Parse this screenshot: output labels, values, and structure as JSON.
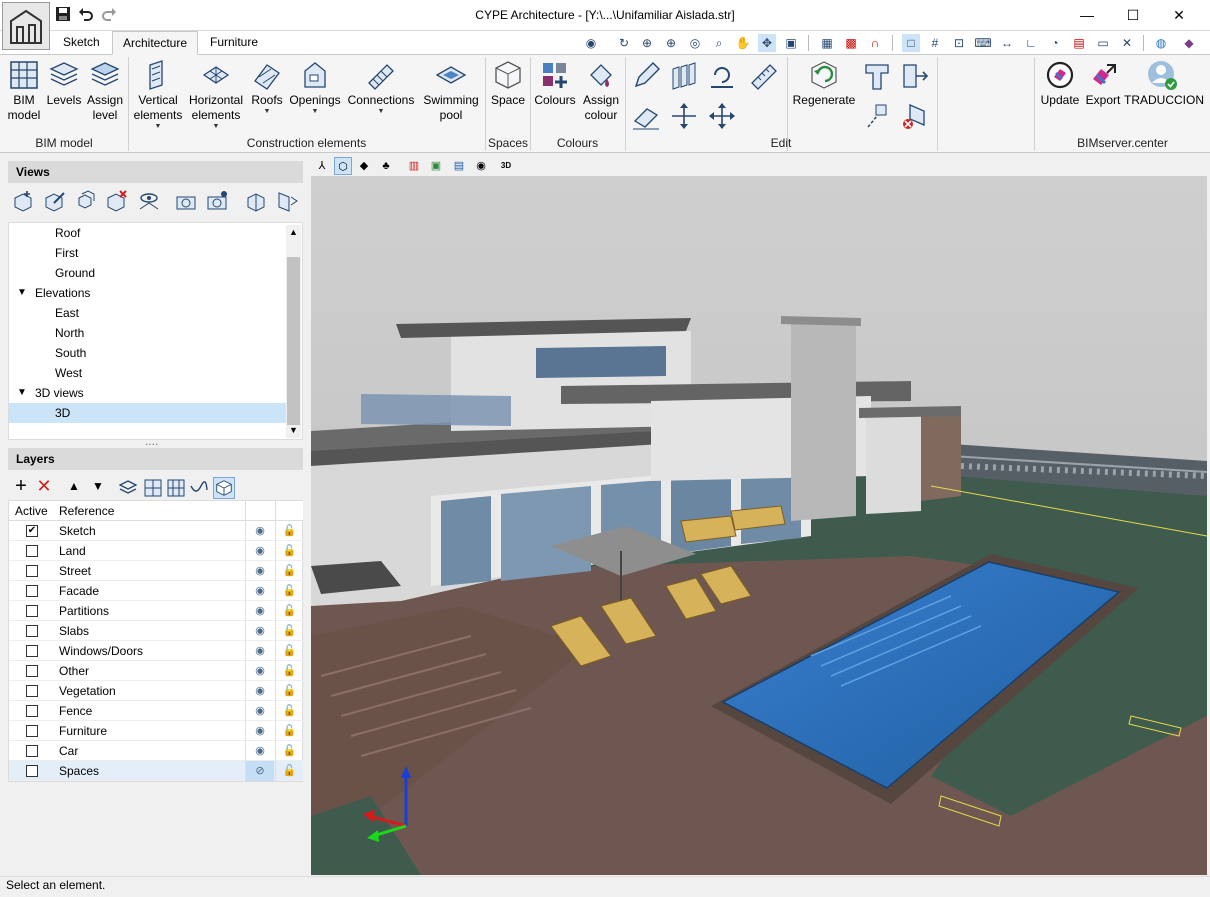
{
  "app": {
    "title": "CYPE Architecture - [Y:\\...\\Unifamiliar Aislada.str]"
  },
  "window_controls": {
    "minimize": "—",
    "maximize": "☐",
    "close": "✕"
  },
  "tabs": [
    {
      "label": "Sketch",
      "active": false
    },
    {
      "label": "Architecture",
      "active": true
    },
    {
      "label": "Furniture",
      "active": false
    }
  ],
  "ribbon": {
    "bim_model": {
      "label_1": "BIM",
      "label_2": "model"
    },
    "levels": {
      "label": "Levels"
    },
    "assign_level": {
      "label_1": "Assign",
      "label_2": "level"
    },
    "vertical_elements": {
      "label_1": "Vertical",
      "label_2": "elements"
    },
    "horizontal_elements": {
      "label_1": "Horizontal",
      "label_2": "elements"
    },
    "roofs": {
      "label": "Roofs"
    },
    "openings": {
      "label": "Openings"
    },
    "connections": {
      "label": "Connections"
    },
    "swimming_pool": {
      "label_1": "Swimming",
      "label_2": "pool"
    },
    "space": {
      "label": "Space"
    },
    "colours": {
      "label": "Colours"
    },
    "assign_colour": {
      "label_1": "Assign",
      "label_2": "colour"
    },
    "regenerate": {
      "label": "Regenerate"
    },
    "update": {
      "label": "Update"
    },
    "export": {
      "label": "Export"
    },
    "traduccion": {
      "label": "TRADUCCION"
    }
  },
  "ribbon_groups": {
    "bim_model": "BIM model",
    "construction": "Construction elements",
    "spaces": "Spaces",
    "colours": "Colours",
    "edit": "Edit",
    "bimserver": "BIMserver.center"
  },
  "views_panel": {
    "title": "Views",
    "items": [
      {
        "label": "Roof",
        "level": 2,
        "selected": false
      },
      {
        "label": "First",
        "level": 2,
        "selected": false
      },
      {
        "label": "Ground",
        "level": 2,
        "selected": false
      },
      {
        "label": "Elevations",
        "level": 1,
        "expandable": true,
        "selected": false
      },
      {
        "label": "East",
        "level": 2,
        "selected": false
      },
      {
        "label": "North",
        "level": 2,
        "selected": false
      },
      {
        "label": "South",
        "level": 2,
        "selected": false
      },
      {
        "label": "West",
        "level": 2,
        "selected": false
      },
      {
        "label": "3D views",
        "level": 1,
        "expandable": true,
        "selected": false
      },
      {
        "label": "3D",
        "level": 2,
        "selected": true
      }
    ],
    "splitter": "...."
  },
  "layers_panel": {
    "title": "Layers",
    "columns": {
      "active": "Active",
      "reference": "Reference"
    },
    "rows": [
      {
        "name": "Sketch",
        "active": true,
        "visible": true
      },
      {
        "name": "Land",
        "active": false,
        "visible": true
      },
      {
        "name": "Street",
        "active": false,
        "visible": true
      },
      {
        "name": "Facade",
        "active": false,
        "visible": true
      },
      {
        "name": "Partitions",
        "active": false,
        "visible": true
      },
      {
        "name": "Slabs",
        "active": false,
        "visible": true
      },
      {
        "name": "Windows/Doors",
        "active": false,
        "visible": true
      },
      {
        "name": "Other",
        "active": false,
        "visible": true
      },
      {
        "name": "Vegetation",
        "active": false,
        "visible": true
      },
      {
        "name": "Fence",
        "active": false,
        "visible": true
      },
      {
        "name": "Furniture",
        "active": false,
        "visible": true
      },
      {
        "name": "Car",
        "active": false,
        "visible": true
      },
      {
        "name": "Spaces",
        "active": false,
        "visible": false,
        "selected": true
      }
    ]
  },
  "viewport": {
    "mode_label": "3D"
  },
  "status": {
    "text": "Select an element."
  },
  "colors": {
    "accent": "#1e5fa8",
    "pool": "#3b7ec4",
    "lawn": "#3d5a4c",
    "deck": "#6e5750"
  }
}
